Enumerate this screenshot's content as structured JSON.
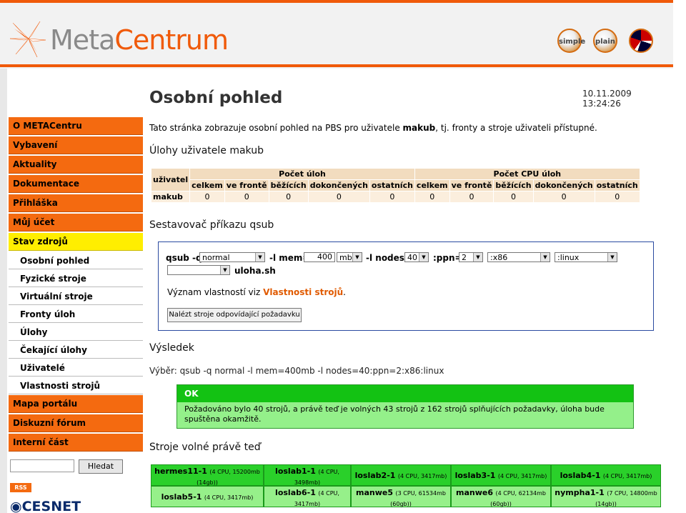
{
  "header": {
    "logo_meta": "Meta",
    "logo_centrum": "Centrum",
    "mode_simple": "simple",
    "mode_plain": "plain",
    "mode_lang": ""
  },
  "sidebar": {
    "items": [
      {
        "label": "O METACentru"
      },
      {
        "label": "Vybavení"
      },
      {
        "label": "Aktuality"
      },
      {
        "label": "Dokumentace"
      },
      {
        "label": "Přihláška"
      },
      {
        "label": "Můj účet"
      },
      {
        "label": "Stav zdrojů"
      }
    ],
    "subitems": [
      {
        "label": "Osobní pohled"
      },
      {
        "label": "Fyzické stroje"
      },
      {
        "label": "Virtuální stroje"
      },
      {
        "label": "Fronty úloh"
      },
      {
        "label": "Úlohy"
      },
      {
        "label": "Čekající úlohy"
      },
      {
        "label": "Uživatelé"
      },
      {
        "label": "Vlastnosti strojů"
      }
    ],
    "items_after": [
      {
        "label": "Mapa portálu"
      },
      {
        "label": "Diskuzní fórum"
      },
      {
        "label": "Interní část"
      }
    ],
    "search_button": "Hledat",
    "search_value": "",
    "rss": "RSS",
    "cesnet": "CESNET"
  },
  "page": {
    "title": "Osobní pohled",
    "datetime": "10.11.2009 13:24:26",
    "intro_prefix": "Tato stránka zobrazuje osobní pohled na PBS pro uživatele ",
    "intro_user": "makub",
    "intro_suffix": ", tj. fronty a stroje uživateli přístupné.",
    "jobs_heading": "Úlohy uživatele makub",
    "qsub_heading": "Sestavovač příkazu qsub",
    "result_heading": "Výsledek",
    "free_heading": "Stroje volné právě teď"
  },
  "jobs_table": {
    "col_user": "uživatel",
    "group_jobs": "Počet úloh",
    "group_cpu": "Počet CPU úloh",
    "subcols": [
      "celkem",
      "ve frontě",
      "běžících",
      "dokončených",
      "ostatních"
    ],
    "rows": [
      {
        "user": "makub",
        "jobs": [
          "0",
          "0",
          "0",
          "0",
          "0"
        ],
        "cpu": [
          "0",
          "0",
          "0",
          "0",
          "0"
        ]
      }
    ]
  },
  "qsub": {
    "lbl_qsub": "qsub -q",
    "queue": "normal",
    "lbl_mem": "-l mem=",
    "mem_value": "400",
    "mem_unit": "mb",
    "lbl_nodes": "-l nodes=",
    "nodes": "40",
    "lbl_ppn": ":ppn=",
    "ppn": "2",
    "arch": ":x86",
    "os": ":linux",
    "extra": "",
    "lbl_script": "uloha.sh",
    "meaning_prefix": "Význam vlastností viz ",
    "meaning_link": "Vlastnosti strojů",
    "meaning_suffix": ".",
    "find_button": "Nalézt stroje odpovídající požadavku"
  },
  "result": {
    "selection": "Výběr: qsub -q normal -l mem=400mb -l nodes=40:ppn=2:x86:linux",
    "status": "OK",
    "message": "Požadováno bylo 40 strojů, a právě teď je volných 43 strojů z 162 strojů splňujících požadavky, úloha bude spuštěna okamžitě."
  },
  "free_machines": [
    {
      "name": "hermes11-1",
      "info1": "(4 CPU, 15200mb",
      "info2": "(14gb))",
      "dark": true
    },
    {
      "name": "loslab1-1",
      "info1": "(4 CPU,",
      "info2": "3498mb)",
      "dark": true
    },
    {
      "name": "loslab2-1",
      "info1": "(4 CPU, 3417mb)",
      "info2": "",
      "dark": true
    },
    {
      "name": "loslab3-1",
      "info1": "(4 CPU, 3417mb)",
      "info2": "",
      "dark": true
    },
    {
      "name": "loslab4-1",
      "info1": "(4 CPU, 3417mb)",
      "info2": "",
      "dark": true
    },
    {
      "name": "loslab5-1",
      "info1": "(4 CPU, 3417mb)",
      "info2": "",
      "dark": false
    },
    {
      "name": "loslab6-1",
      "info1": "(4 CPU,",
      "info2": "3417mb)",
      "dark": false
    },
    {
      "name": "manwe5",
      "info1": "(3 CPU, 61534mb",
      "info2": "(60gb))",
      "dark": false
    },
    {
      "name": "manwe6",
      "info1": "(4 CPU, 62134mb",
      "info2": "(60gb))",
      "dark": false
    },
    {
      "name": "nympha1-1",
      "info1": "(7 CPU, 14800mb",
      "info2": "(14gb))",
      "dark": false
    }
  ],
  "colors": {
    "brand_orange": "#f05a0a",
    "nav_active": "#ffee00",
    "ok_green": "#13c213"
  }
}
